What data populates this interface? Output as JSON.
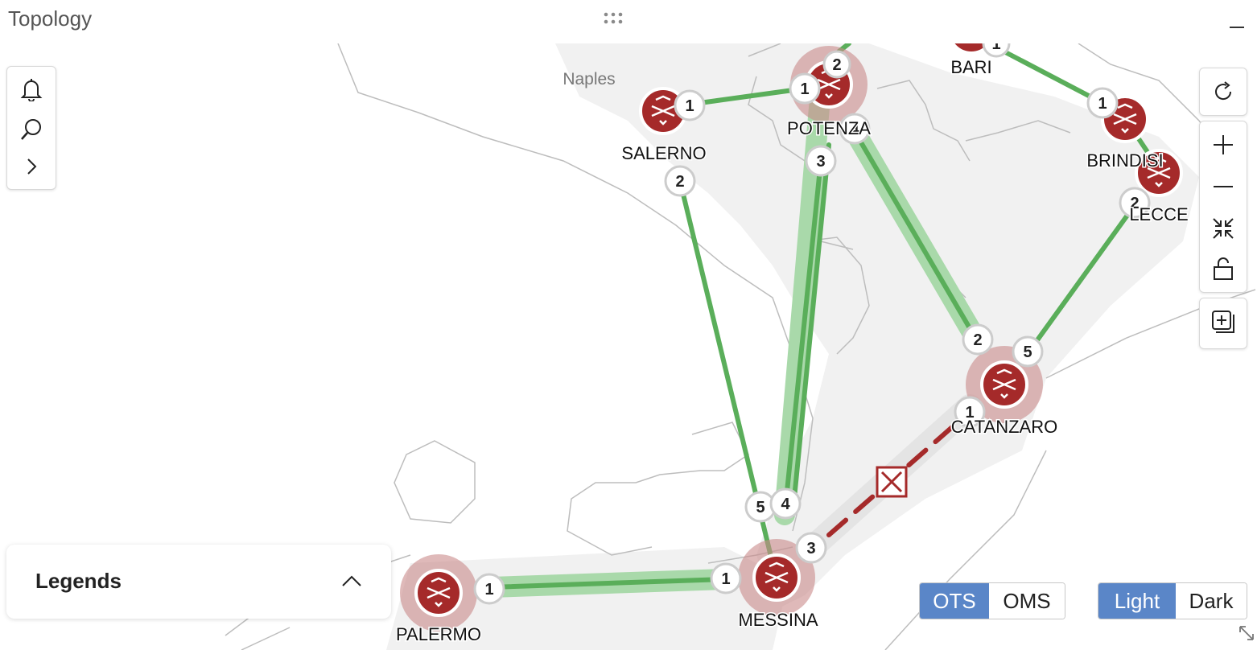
{
  "window": {
    "title": "Topology"
  },
  "map": {
    "city_labels": [
      "Naples"
    ],
    "nodes": [
      {
        "id": "salerno",
        "label": "SALERNO"
      },
      {
        "id": "potenza",
        "label": "POTENZA"
      },
      {
        "id": "bari",
        "label": "BARI"
      },
      {
        "id": "brindisi",
        "label": "BRINDISI"
      },
      {
        "id": "lecce",
        "label": "LECCE"
      },
      {
        "id": "catanzaro",
        "label": "CATANZARO"
      },
      {
        "id": "messina",
        "label": "MESSINA"
      },
      {
        "id": "palermo",
        "label": "PALERMO"
      }
    ],
    "ports": [
      "1",
      "1",
      "3",
      "4",
      "2",
      "1",
      "2",
      "2",
      "5",
      "1",
      "1",
      "5",
      "4",
      "3",
      "1",
      "1",
      "2"
    ],
    "colors": {
      "link_ok": "#5aae5a",
      "link_halo": "#a9d9aa",
      "link_fault": "#a52a2a",
      "node": "#a52a2a",
      "node_halo": "#c98a8a"
    }
  },
  "controls": {
    "left": [
      "bell-icon",
      "search-icon",
      "chevron-right-icon"
    ],
    "right": [
      "refresh-icon",
      "zoom-in-icon",
      "zoom-out-icon",
      "fit-icon",
      "lock-icon",
      "add-layer-icon"
    ]
  },
  "legend": {
    "title": "Legends"
  },
  "layer_toggle": {
    "ots": "OTS",
    "oms": "OMS"
  },
  "theme_toggle": {
    "light": "Light",
    "dark": "Dark"
  }
}
